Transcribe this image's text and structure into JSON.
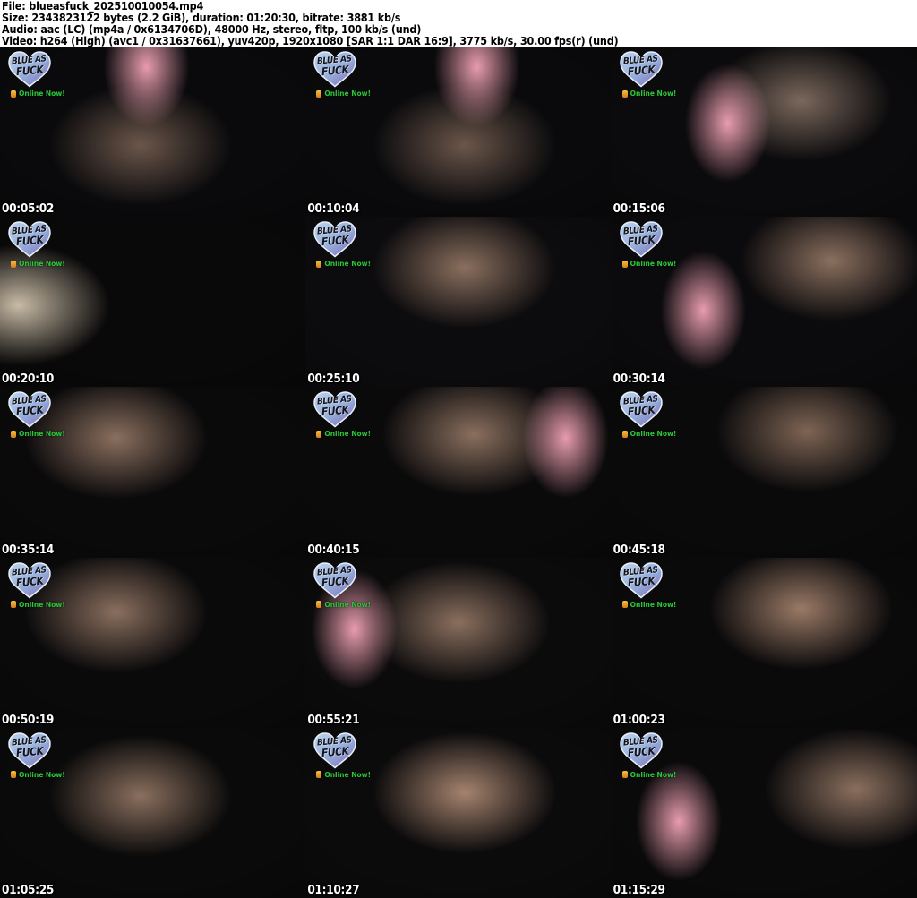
{
  "header": {
    "lines": [
      "File: blueasfuck_202510010054.mp4",
      "Size: 2343823122 bytes (2.2 GiB), duration: 01:20:30, bitrate: 3881 kb/s",
      "Audio: aac (LC) (mp4a / 0x6134706D), 48000 Hz, stereo, fltp, 100 kb/s (und)",
      "Video: h264 (High) (avc1 / 0x31637661), yuv420p, 1920x1080 [SAR 1:1 DAR 16:9], 3775 kb/s, 30.00 fps(r) (und)"
    ]
  },
  "watermark": {
    "line1": "BLUE AS",
    "line2": "FUCK",
    "status": "Online Now!",
    "heart_top": "#bdd4ee",
    "heart_mid": "#96aede",
    "heart_bottom": "#7e6fb4",
    "status_color": "#2fc33b",
    "icon_color": "#e6a31f"
  },
  "grid": {
    "columns": 3,
    "rows": 5
  },
  "thumbnails": [
    {
      "timestamp": "00:05:02",
      "base": "#0a0a0c",
      "glow": "#6b564a",
      "glow_at": "46% 58%",
      "accent": "#e89cae",
      "accent_at": "48% 12%"
    },
    {
      "timestamp": "00:10:04",
      "base": "#0a0a0c",
      "glow": "#6b564a",
      "glow_at": "52% 58%",
      "accent": "#e89cae",
      "accent_at": "56% 12%"
    },
    {
      "timestamp": "00:15:06",
      "base": "#0b0a0c",
      "glow": "#7a685c",
      "glow_at": "62% 32%",
      "accent": "#e89cae",
      "accent_at": "38% 45%"
    },
    {
      "timestamp": "00:20:10",
      "base": "#0a0909",
      "glow": "#c8bba6",
      "glow_at": "6% 52%",
      "accent": null,
      "accent_at": null
    },
    {
      "timestamp": "00:25:10",
      "base": "#0c0b0d",
      "glow": "#8a6f5e",
      "glow_at": "52% 30%",
      "accent": null,
      "accent_at": null
    },
    {
      "timestamp": "00:30:14",
      "base": "#0b0a0c",
      "glow": "#8a6f5e",
      "glow_at": "72% 26%",
      "accent": "#e89cae",
      "accent_at": "30% 55%"
    },
    {
      "timestamp": "00:35:14",
      "base": "#0b0a0b",
      "glow": "#8a6f5e",
      "glow_at": "38% 30%",
      "accent": null,
      "accent_at": null
    },
    {
      "timestamp": "00:40:15",
      "base": "#0b0a0b",
      "glow": "#8a6f5e",
      "glow_at": "55% 28%",
      "accent": "#e89cae",
      "accent_at": "85% 30%"
    },
    {
      "timestamp": "00:45:18",
      "base": "#0a0a0b",
      "glow": "#7e6454",
      "glow_at": "64% 26%",
      "accent": null,
      "accent_at": null
    },
    {
      "timestamp": "00:50:19",
      "base": "#0b0a0b",
      "glow": "#8a6f5e",
      "glow_at": "38% 32%",
      "accent": null,
      "accent_at": null
    },
    {
      "timestamp": "00:55:21",
      "base": "#0c0b0c",
      "glow": "#8a6f5e",
      "glow_at": "50% 38%",
      "accent": "#e89cae",
      "accent_at": "16% 42%"
    },
    {
      "timestamp": "01:00:23",
      "base": "#0b0a0b",
      "glow": "#9a7a66",
      "glow_at": "62% 30%",
      "accent": null,
      "accent_at": null
    },
    {
      "timestamp": "01:05:25",
      "base": "#0a0a0a",
      "glow": "#8a6f5e",
      "glow_at": "46% 40%",
      "accent": null,
      "accent_at": null
    },
    {
      "timestamp": "01:10:27",
      "base": "#0c0b0c",
      "glow": "#a5836e",
      "glow_at": "52% 38%",
      "accent": null,
      "accent_at": null
    },
    {
      "timestamp": "01:15:29",
      "base": "#0b0a0b",
      "glow": "#8a6f5e",
      "glow_at": "80% 36%",
      "accent": "#e89cae",
      "accent_at": "22% 55%"
    }
  ],
  "colors": {
    "page_bg": "#ffffff",
    "header_text": "#000000",
    "timestamp_text": "#ffffff",
    "timestamp_outline": "#000000",
    "chair_pink": "#e89cae"
  }
}
